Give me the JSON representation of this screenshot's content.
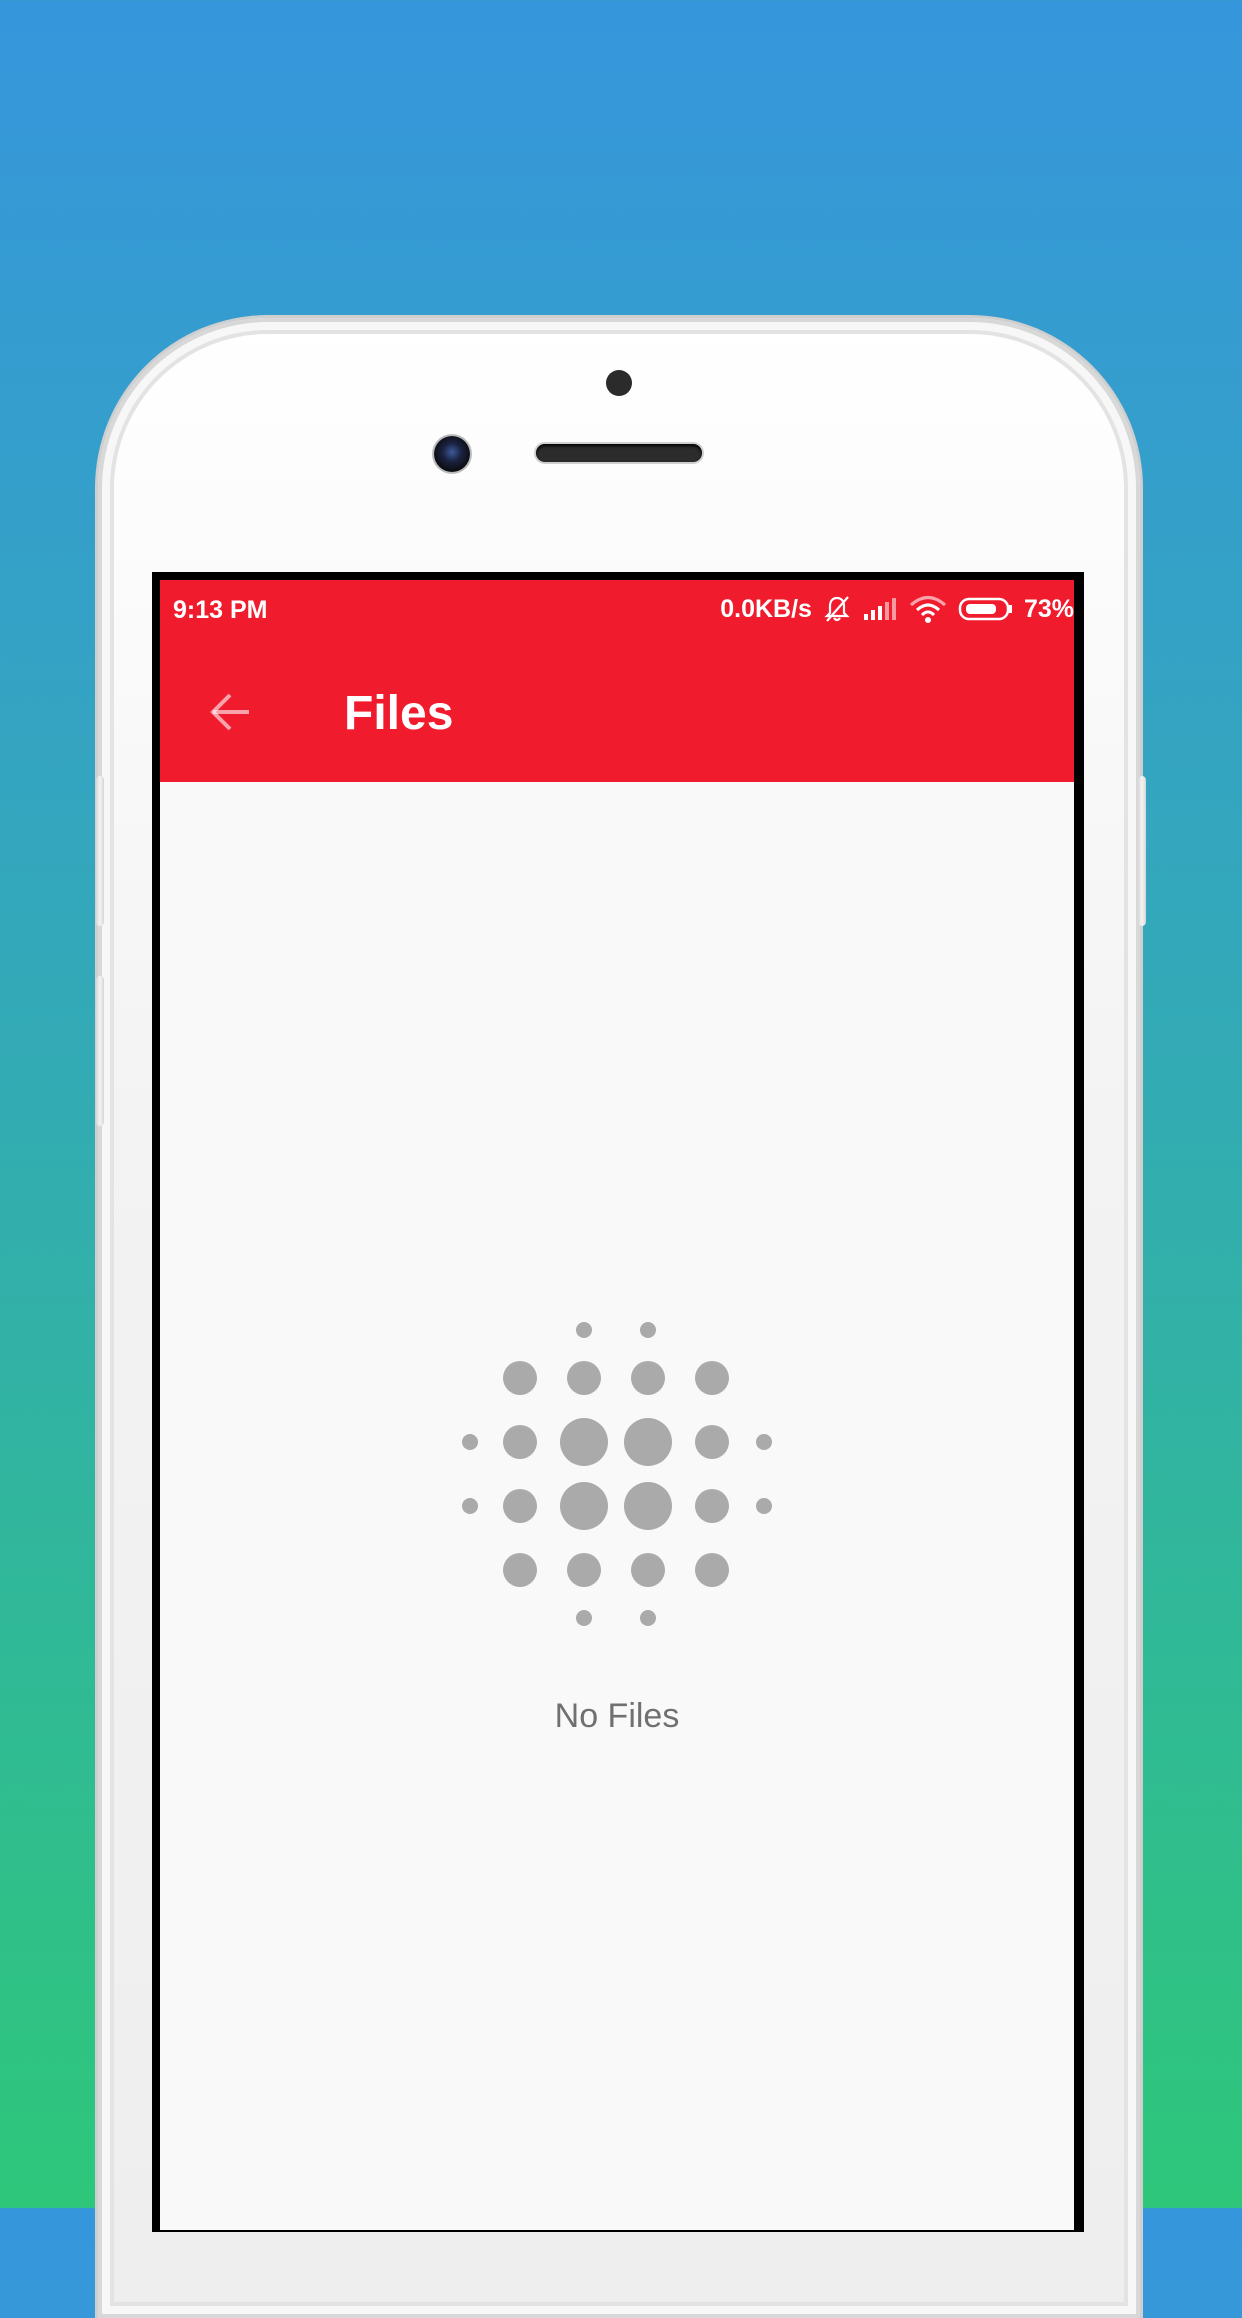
{
  "status_bar": {
    "time": "9:13 PM",
    "network_speed": "0.0KB/s",
    "battery_percent": "73%",
    "icons": [
      "notifications-off-icon",
      "signal-icon",
      "wifi-icon",
      "battery-icon"
    ],
    "color": "#f01c2e"
  },
  "app_bar": {
    "title": "Files",
    "back_icon": "arrow-back-icon",
    "color": "#f01c2e"
  },
  "empty_state": {
    "icon": "dot-pattern-icon",
    "message": "No Files",
    "icon_color": "#a9aaa9"
  }
}
